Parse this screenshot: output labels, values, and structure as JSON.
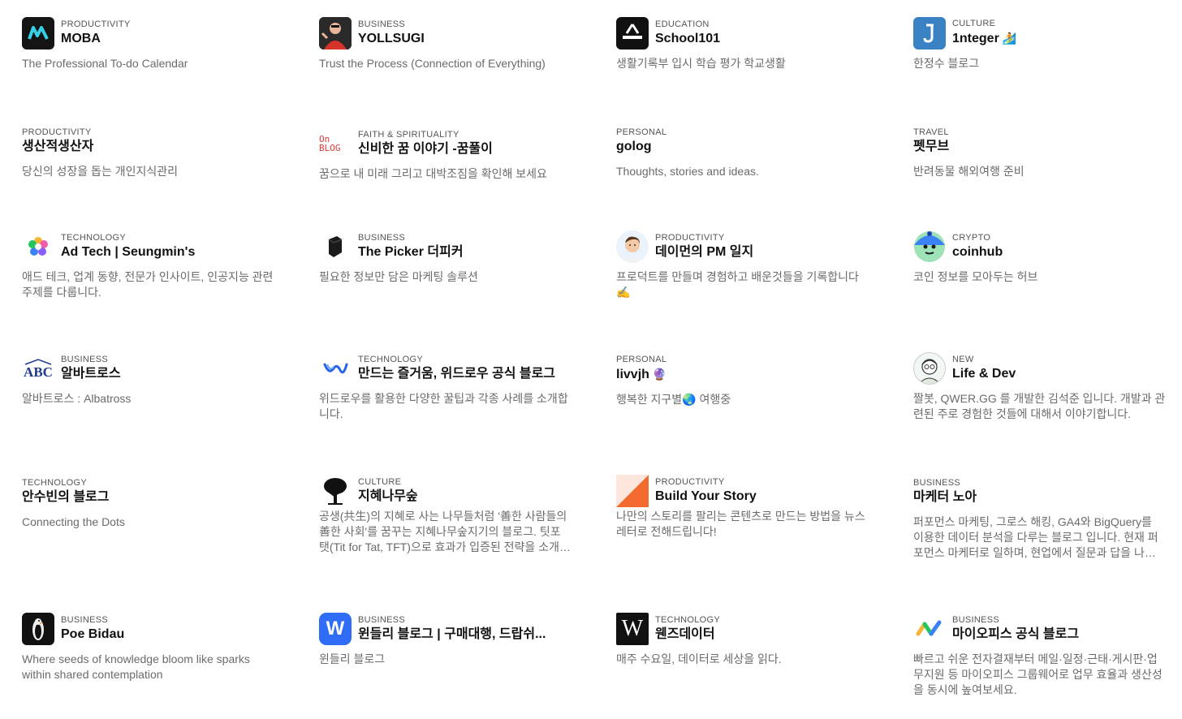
{
  "cards": [
    {
      "category": "PRODUCTIVITY",
      "name": "MOBA",
      "desc": "The Professional To-do Calendar",
      "logo": "moba-logo"
    },
    {
      "category": "BUSINESS",
      "name": "YOLLSUGI",
      "desc": "Trust the Process (Connection of Everything)",
      "logo": "person-photo"
    },
    {
      "category": "EDUCATION",
      "name": "School101",
      "desc": "생활기록부 입시 학습 평가 학교생활",
      "logo": "school-logo"
    },
    {
      "category": "CULTURE",
      "name": "1nteger",
      "name_emoji": "🏄",
      "desc": "한정수 블로그",
      "logo": "j-logo"
    },
    {
      "category": "PRODUCTIVITY",
      "name": "생산적생산자",
      "desc": "당신의 성장을 돕는 개인지식관리"
    },
    {
      "category": "FAITH & SPIRITUALITY",
      "name": "신비한 꿈 이야기 -꿈풀이",
      "desc": "꿈으로 내 미래 그리고 대박조짐을 확인해 보세요",
      "logo": "on-blog-logo",
      "logo_text_1": "On",
      "logo_text_2": "BLOG"
    },
    {
      "category": "PERSONAL",
      "name": "golog",
      "desc": "Thoughts, stories and ideas."
    },
    {
      "category": "TRAVEL",
      "name": "펫무브",
      "desc": "반려동물 해외여행 준비"
    },
    {
      "category": "TECHNOLOGY",
      "name": "Ad Tech | Seungmin's",
      "desc": "애드 테크, 업계 동향, 전문가 인사이트, 인공지능 관련 주제를 다룹니다.",
      "logo": "flower-logo"
    },
    {
      "category": "BUSINESS",
      "name": "The Picker 더피커",
      "desc": "필요한 정보만 담은 마케팅 솔루션",
      "logo": "cube-logo"
    },
    {
      "category": "PRODUCTIVITY",
      "name": "데이먼의 PM 일지",
      "desc": "프로덕트를 만들며 경험하고 배운것들을 기록합니다 ✍️",
      "logo": "avatar-man"
    },
    {
      "category": "CRYPTO",
      "name": "coinhub",
      "desc": "코인 정보를 모아두는 허브",
      "logo": "robot-logo"
    },
    {
      "category": "BUSINESS",
      "name": "알바트로스",
      "desc": "알바트로스 : Albatross",
      "logo": "abc-logo",
      "logo_text": "ABC"
    },
    {
      "category": "TECHNOLOGY",
      "name": "만드는 즐거움, 위드로우 공식 블로그",
      "desc": "위드로우를 활용한 다양한 꿀팁과 각종 사례를 소개합니다.",
      "logo": "wave-logo"
    },
    {
      "category": "PERSONAL",
      "name": "livvjh",
      "name_emoji": "🔮",
      "desc": "행복한 지구별🌏 여행중"
    },
    {
      "category": "NEW",
      "name": "Life & Dev",
      "desc": "짤봇, QWER.GG 를 개발한 김석준 입니다. 개발과 관련된 주로 경험한 것들에 대해서 이야기합니다.",
      "logo": "avatar-sketch"
    },
    {
      "category": "TECHNOLOGY",
      "name": "안수빈의 블로그",
      "desc": "Connecting the Dots"
    },
    {
      "category": "CULTURE",
      "name": "지혜나무숲",
      "desc": "공생(共生)의 지혜로 사는 나무들처럼 '善한 사람들의 善한 사회'를 꿈꾸는 지혜나무숲지기의 블로그. 팃포탯(Tit for Tat, TFT)으로 효과가 입증된 전략을 소개합니다.",
      "logo": "tree-logo"
    },
    {
      "category": "PRODUCTIVITY",
      "name": "Build Your Story",
      "desc": "나만의 스토리를 팔리는 콘텐츠로 만드는 방법을 뉴스레터로 전해드립니다!",
      "logo": "orange-triangle-logo"
    },
    {
      "category": "BUSINESS",
      "name": "마케터 노아",
      "desc": "퍼포먼스 마케팅, 그로스 해킹, GA4와 BigQuery를 이용한 데이터 분석을 다루는 블로그 입니다. 현재 퍼포먼스 마케터로 일하며, 현업에서 질문과 답을 나눕니다."
    },
    {
      "category": "BUSINESS",
      "name": "Poe Bidau",
      "desc": "Where seeds of knowledge bloom like sparks within shared contemplation",
      "logo": "penguin-logo"
    },
    {
      "category": "BUSINESS",
      "name": "윈들리 블로그 | 구매대행, 드랍쉬...",
      "desc": "윈들리 블로그",
      "logo": "w-logo",
      "logo_text": "W"
    },
    {
      "category": "TECHNOLOGY",
      "name": "웬즈데이터",
      "desc": "매주 수요일, 데이터로 세상을 읽다.",
      "logo": "wiki-logo",
      "logo_text": "W"
    },
    {
      "category": "BUSINESS",
      "name": "마이오피스 공식 블로그",
      "desc": "빠르고 쉬운 전자결재부터 메일·일정·근태·게시판·업무지원 등 마이오피스 그룹웨어로 업무 효율과 생산성을 동시에 높여보세요.",
      "logo": "myoffice-logo"
    }
  ],
  "colors": {
    "category": "#555555",
    "name": "#111111",
    "desc": "#6b6b6b",
    "accent_orange": "#f26a2e"
  }
}
